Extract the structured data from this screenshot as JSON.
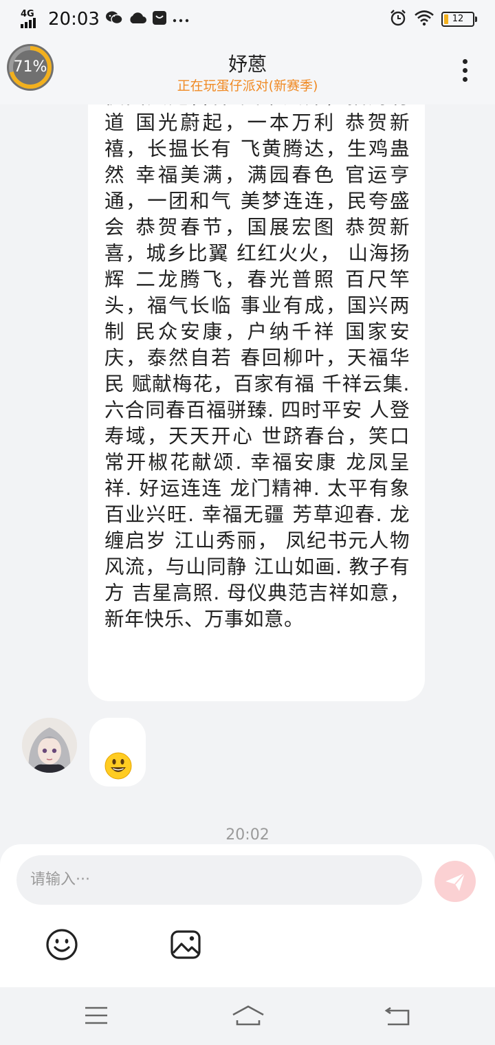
{
  "status_bar": {
    "network": "4G",
    "time": "20:03",
    "battery": "12",
    "icons": [
      "wechat-icon",
      "cloud-icon",
      "bag-icon",
      "more-dots-icon",
      "alarm-icon",
      "wifi-icon",
      "battery-icon"
    ]
  },
  "header": {
    "gauge": "71%",
    "gauge_level": 0.71,
    "title": "妤蒽",
    "subtitle": "正在玩蛋仔派对(新赛季)",
    "more_icon": "more-vertical-icon"
  },
  "messages": {
    "text": "侯国文定吉祥 美千兴邦，招财有道 国光蔚起，一本万利 恭贺新禧，长揾长有 飞黄腾达，生鸡蛊然 幸福美满，满园春色 官运亨通，一团和气 美梦连连，民夸盛会 恭贺春节，国展宏图 恭贺新喜，城乡比翼 红红火火， 山海扬辉 二龙腾飞，春光普照 百尺竿头，福气长临 事业有成，国兴两制 民众安康，户纳千祥 国家安庆，泰然自若 春回柳叶，天福华民 赋献梅花，百家有福 千祥云集. 六合同春百福骈臻. 四时平安 人登寿域，天天开心 世跻春台，笑口常开椒花献颂. 幸福安康 龙凤呈祥. 好运连连 龙门精神. 太平有象百业兴旺. 幸福无疆 芳草迎春. 龙缠启岁 江山秀丽， 凤纪书元人物风流，与山同静 江山如画. 教子有方 吉星高照. 母仪典范吉祥如意，新年快乐、万事如意。",
    "emoji_message": "smiley-emoji",
    "timestamp": "20:02"
  },
  "composer": {
    "placeholder": "请输入···",
    "send_icon": "paper-plane-icon",
    "emoji_tool_icon": "emoji-icon",
    "image_tool_icon": "image-icon"
  },
  "navbar": {
    "icons": [
      "menu-icon",
      "home-icon",
      "back-icon"
    ]
  },
  "colors": {
    "accent_orange": "#f08a24",
    "send_button": "#fbd1d3",
    "background": "#f2f3f5"
  }
}
